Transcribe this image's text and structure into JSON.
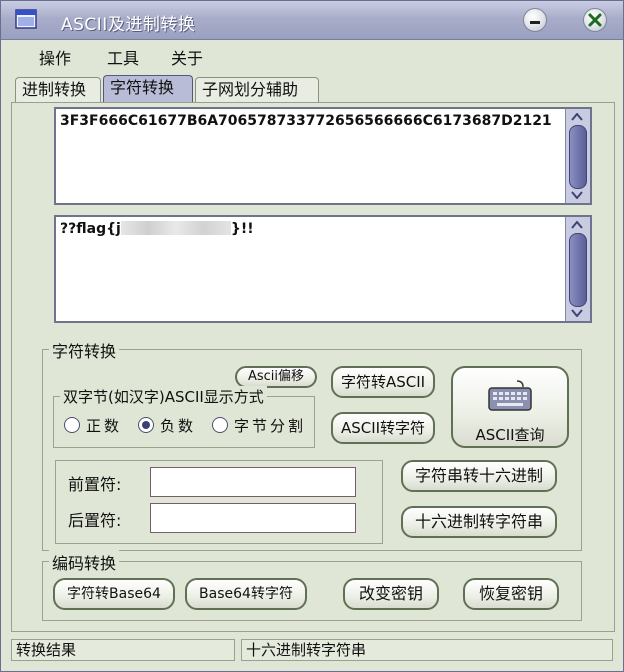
{
  "window": {
    "title": "ASCII及进制转换"
  },
  "menu": {
    "items": [
      "操作",
      "工具",
      "关于"
    ]
  },
  "tabs": [
    "进制转换",
    "字符转换",
    "子网划分辅助"
  ],
  "active_tab_index": 1,
  "hex_text": "3F3F666C61677B6A706578733772656566666C6173687D2121",
  "char_text": "??flag{j",
  "char_text_tail": "}!!",
  "char_group": {
    "label": "字符转换",
    "ascii_offset_button": "Ascii偏移",
    "double_byte_label": "双字节(如汉字)ASCII显示方式",
    "radio_options": [
      "正数",
      "负数",
      "字节分割"
    ],
    "radio_selected_index": 1,
    "char_to_ascii_button": "字符转ASCII",
    "ascii_to_char_button": "ASCII转字符",
    "ascii_query_button": "ASCII查询",
    "prefix_label": "前置符:",
    "suffix_label": "后置符:",
    "prefix_value": "",
    "suffix_value": "",
    "str_to_hex_button": "字符串转十六进制",
    "hex_to_str_button": "十六进制转字符串"
  },
  "encode_group": {
    "label": "编码转换",
    "to_base64_button": "字符转Base64",
    "from_base64_button": "Base64转字符",
    "change_key_button": "改变密钥",
    "restore_key_button": "恢复密钥"
  },
  "status": {
    "left": "转换结果",
    "right": "十六进制转字符串"
  },
  "colors": {
    "title_bar": "#a9adc9",
    "accent": "#5a5f97",
    "window_bg": "#dfe6d6"
  }
}
